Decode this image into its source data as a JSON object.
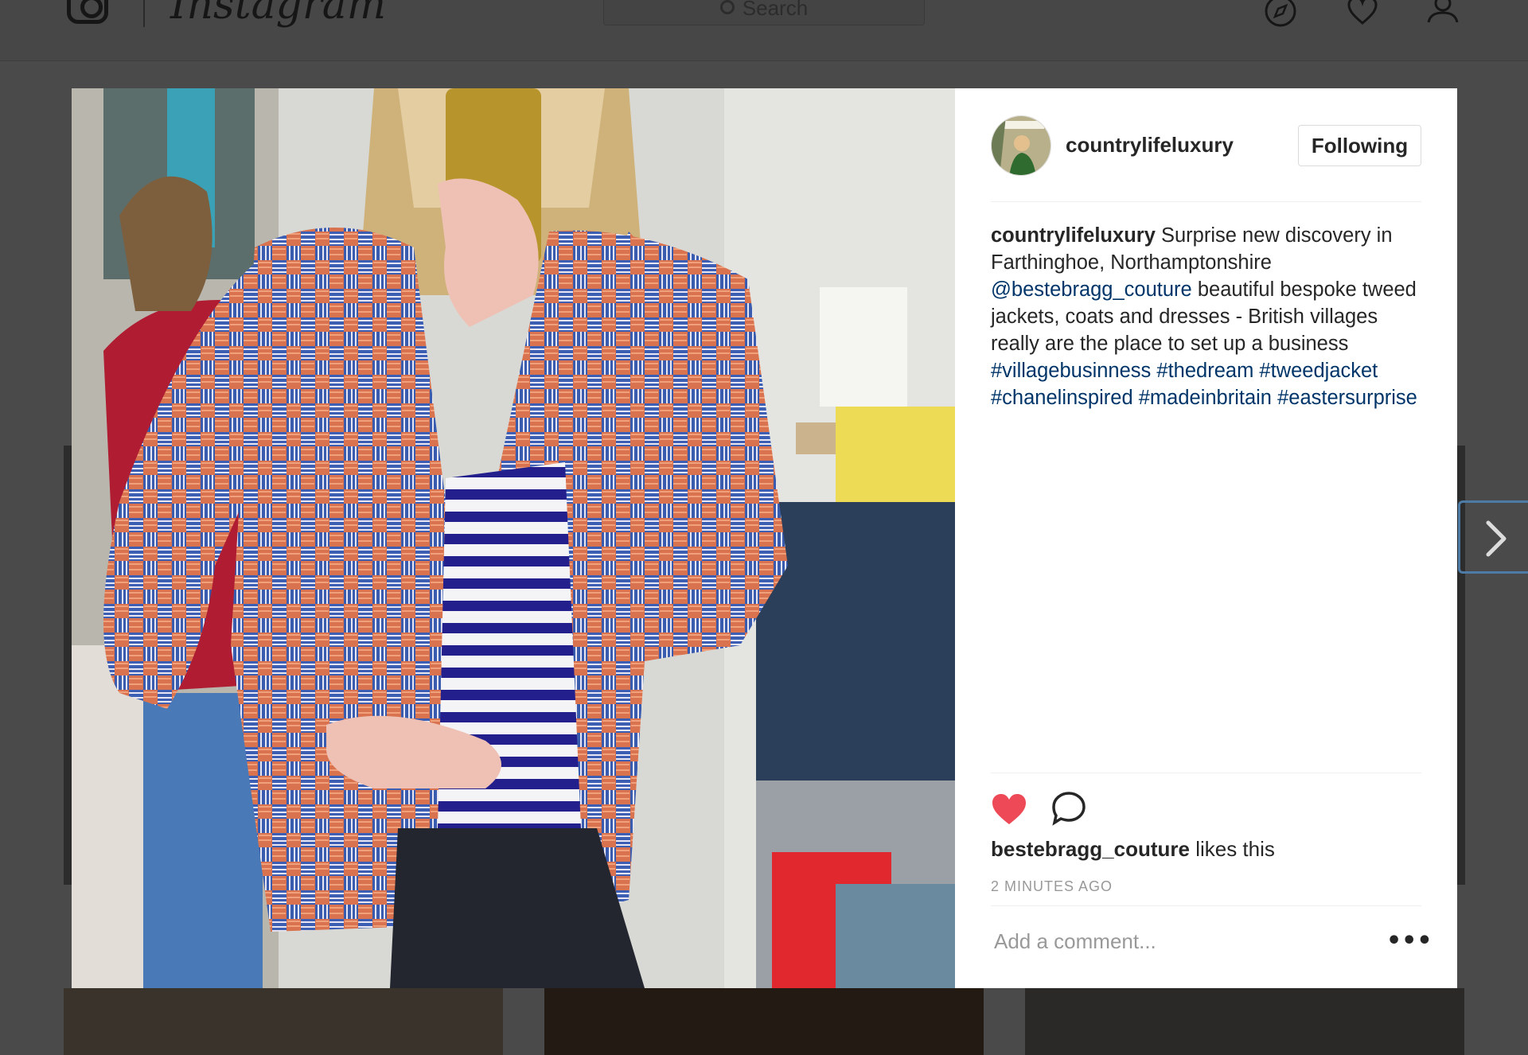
{
  "nav": {
    "wordmark": "Instagram",
    "search_placeholder": "Search",
    "icons": [
      "instagram-logo-icon",
      "compass-icon",
      "heart-icon",
      "profile-icon"
    ]
  },
  "post": {
    "header": {
      "username": "countrylifeluxury",
      "follow_label": "Following"
    },
    "caption": {
      "username": "countrylifeluxury",
      "text_1": "Surprise new discovery in Farthinghoe, Northamptonshire",
      "mention": "@bestebragg_couture",
      "text_2": "beautiful bespoke tweed jackets, coats and dresses - British villages really are the place to set up a business",
      "hashtags": [
        "#villagebusinness",
        "#thedream",
        "#tweedjacket",
        "#chanelinspired",
        "#madeinbritain",
        "#eastersurprise"
      ]
    },
    "likes": {
      "liker": "bestebragg_couture",
      "suffix": "likes this"
    },
    "timestamp": "2 MINUTES AGO",
    "comment_placeholder": "Add a comment...",
    "more_label": "•••"
  },
  "colors": {
    "like_red": "#ed4956",
    "link_blue": "#003569",
    "text": "#262626",
    "muted": "#999999",
    "overlay": "#4a4a4a"
  }
}
